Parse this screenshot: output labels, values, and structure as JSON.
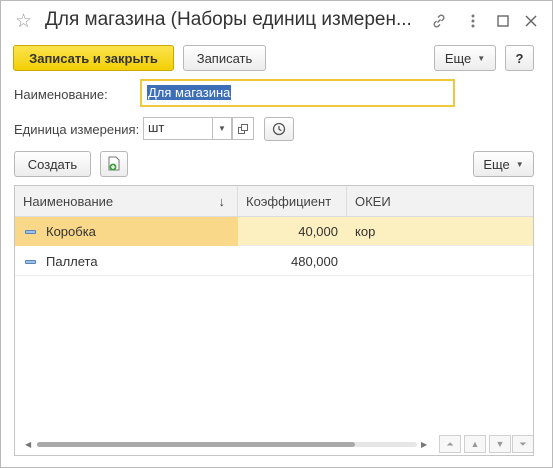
{
  "window": {
    "title": "Для магазина (Наборы единиц измерен..."
  },
  "toolbar": {
    "save_close_label": "Записать и закрыть",
    "save_label": "Записать",
    "more_label": "Еще",
    "help_label": "?"
  },
  "form": {
    "name_label": "Наименование:",
    "name_value": "Для магазина",
    "unit_label": "Единица измерения:",
    "unit_value": "шт"
  },
  "list_toolbar": {
    "create_label": "Создать",
    "more_label": "Еще"
  },
  "table": {
    "columns": [
      "Наименование",
      "Коэффициент",
      "ОКЕИ"
    ],
    "sort_indicator": "↓",
    "rows": [
      {
        "name": "Коробка",
        "coefficient": "40,000",
        "okei": "кор"
      },
      {
        "name": "Паллета",
        "coefficient": "480,000",
        "okei": ""
      }
    ]
  },
  "colors": {
    "primary_button": "#f3cf06",
    "selected_row": "#fcefc0",
    "selected_cell": "#f9d88a",
    "focus_border": "#f0c93a",
    "text_selection": "#3d6fb8"
  }
}
